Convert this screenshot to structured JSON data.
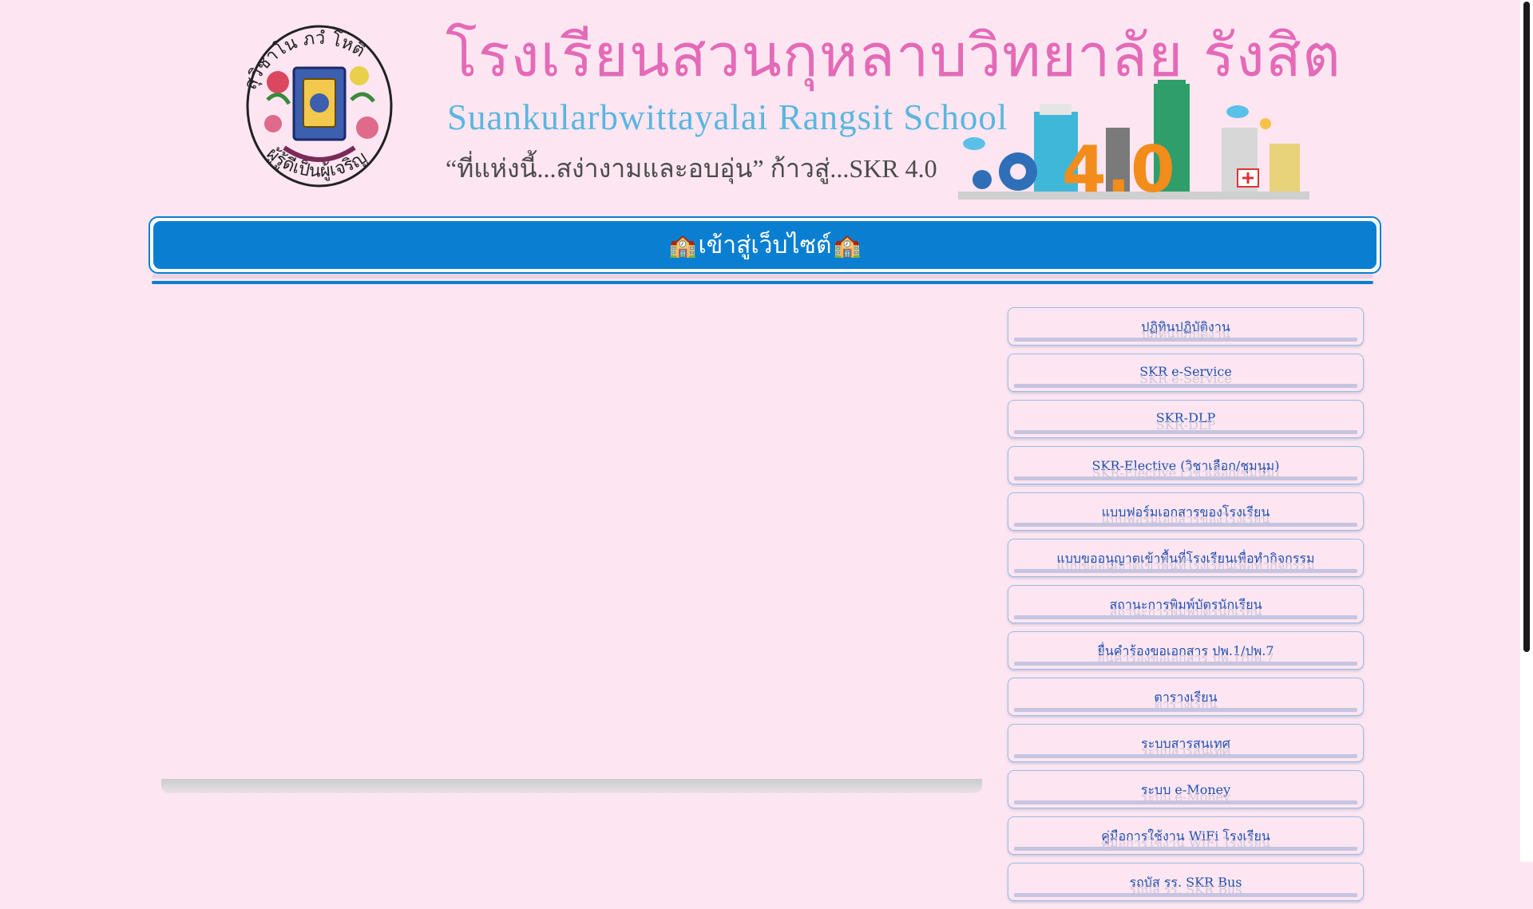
{
  "header": {
    "title_th": "โรงเรียนสวนกุหลาบวิทยาลัย รังสิต",
    "title_en": "Suankularbwittayalai Rangsit School",
    "slogan": "“ที่แห่งนี้...สง่างามและอบอุ่น”  ก้าวสู่...SKR 4.0",
    "emblem_top_text": "สุวิชาโน ภวํ โหติ",
    "emblem_bottom_text": "ผู้รู้ดีเป็นผู้เจริญ",
    "city_badge": "4.0"
  },
  "enter_button": {
    "icon_left": "school-icon",
    "label": "เข้าสู่เว็บไซต์",
    "icon_right": "school-icon",
    "icon_glyph": "🏫"
  },
  "links": [
    {
      "label": "ปฏิทินปฏิบัติงาน"
    },
    {
      "label": "SKR e-Service"
    },
    {
      "label": "SKR-DLP"
    },
    {
      "label": "SKR-Elective (วิชาเลือก/ชุมนุม)"
    },
    {
      "label": "แบบฟอร์มเอกสารของโรงเรียน"
    },
    {
      "label": "แบบขออนุญาตเข้าพื้นที่โรงเรียนเพื่อทำกิจกรรม"
    },
    {
      "label": "สถานะการพิมพ์บัตรนักเรียน"
    },
    {
      "label": "ยื่นคำร้องขอเอกสาร ปพ.1/ปพ.7"
    },
    {
      "label": "ตารางเรียน"
    },
    {
      "label": "ระบบสารสนเทศ"
    },
    {
      "label": "ระบบ e-Money"
    },
    {
      "label": "คู่มือการใช้งาน WiFi โรงเรียน"
    },
    {
      "label": "รถบัส รร. SKR Bus"
    }
  ],
  "colors": {
    "background": "#fde6f1",
    "accent_blue": "#0a7fd1",
    "title_pink": "#e46ab8",
    "title_blue": "#5bb6df",
    "link_text": "#1e4fb0"
  }
}
